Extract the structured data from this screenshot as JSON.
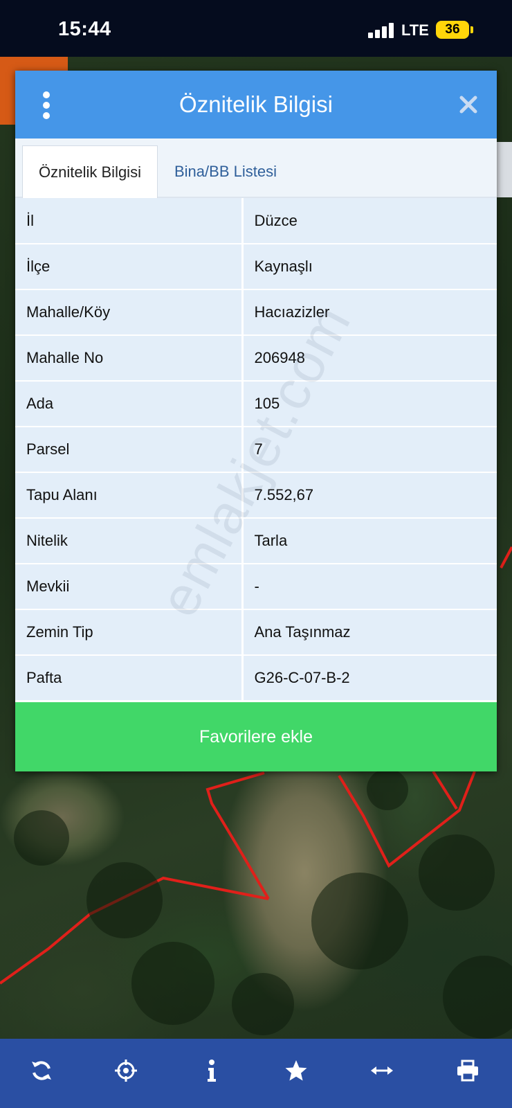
{
  "status_bar": {
    "time": "15:44",
    "network": "LTE",
    "battery": "36"
  },
  "dialog": {
    "title": "Öznitelik Bilgisi",
    "tabs": [
      {
        "label": "Öznitelik Bilgisi",
        "active": true
      },
      {
        "label": "Bina/BB Listesi",
        "active": false
      }
    ],
    "rows": [
      {
        "key": "İl",
        "value": "Düzce"
      },
      {
        "key": "İlçe",
        "value": "Kaynaşlı"
      },
      {
        "key": "Mahalle/Köy",
        "value": "Hacıazizler"
      },
      {
        "key": "Mahalle No",
        "value": "206948"
      },
      {
        "key": "Ada",
        "value": "105"
      },
      {
        "key": "Parsel",
        "value": "7"
      },
      {
        "key": "Tapu Alanı",
        "value": "7.552,67"
      },
      {
        "key": "Nitelik",
        "value": "Tarla"
      },
      {
        "key": "Mevkii",
        "value": "-"
      },
      {
        "key": "Zemin Tip",
        "value": "Ana Taşınmaz"
      },
      {
        "key": "Pafta",
        "value": "G26-C-07-B-2"
      }
    ],
    "favorite_button": "Favorilere ekle"
  },
  "watermark": "emlakjet.com",
  "toolbar": {
    "icons": [
      "refresh-icon",
      "locate-icon",
      "info-icon",
      "star-icon",
      "measure-icon",
      "print-icon"
    ]
  },
  "colors": {
    "header": "#4596e8",
    "favorite": "#41d768",
    "toolbar": "#2a4fa3",
    "parcel_border": "#e0201a"
  }
}
